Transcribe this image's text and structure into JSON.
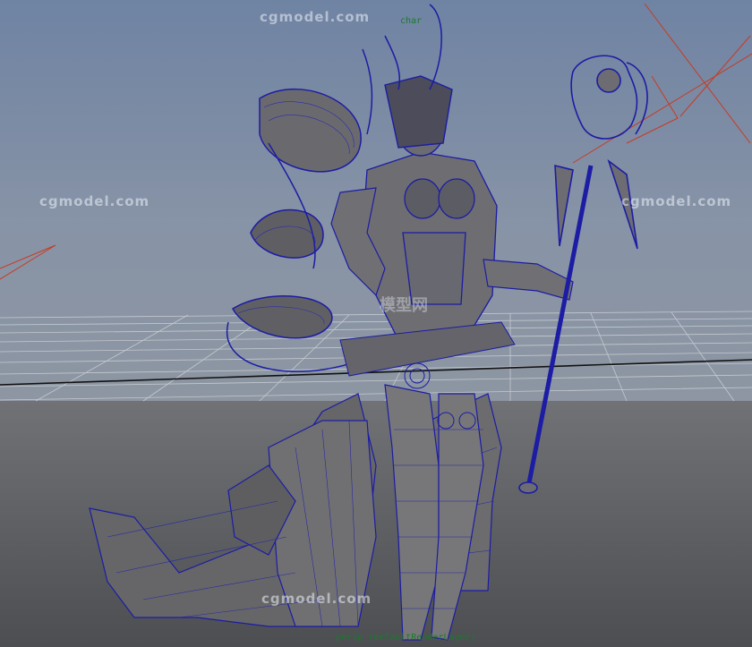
{
  "watermark": {
    "text": "cgmodel.com",
    "logo_text": "模型网"
  },
  "hud": {
    "camera_label": "persp (defaultRenderLayer)",
    "top_label": "char"
  },
  "colors": {
    "sky_top": "#788aa8",
    "sky_bottom": "#8a95a4",
    "ground": "#5a5c60",
    "wireframe": "#1a1aa0",
    "mesh_fill": "#6a6a6a",
    "grid_line": "#d0d4d8",
    "camera_line": "#c83820"
  }
}
